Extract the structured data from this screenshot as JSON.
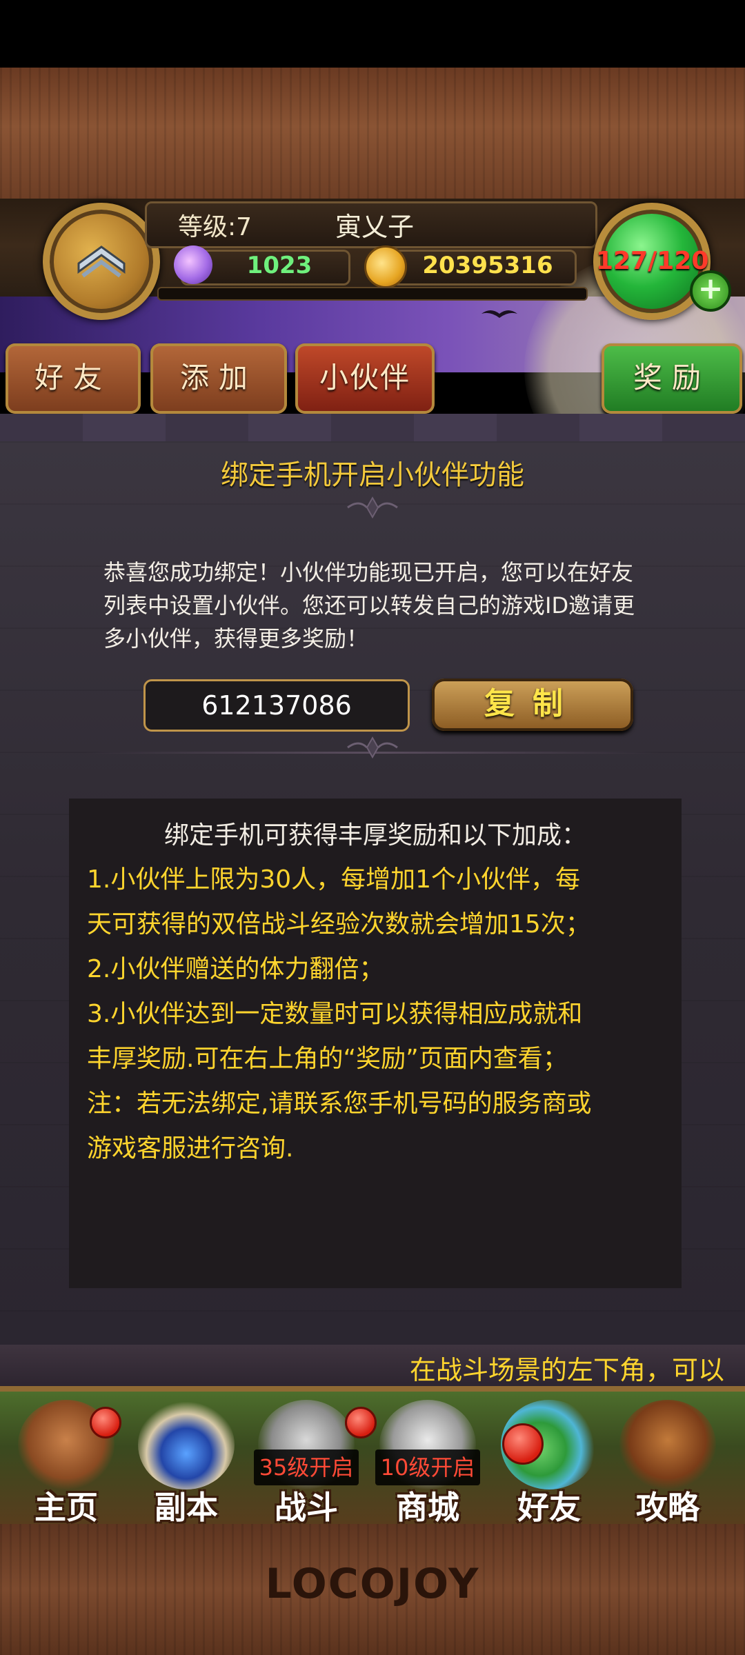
{
  "header": {
    "level_label": "等级:7",
    "player_name": "寅乂子",
    "gems": "1023",
    "gold": "20395316",
    "energy": "127/120",
    "plus_label": "+"
  },
  "tabs": [
    {
      "label": "好友"
    },
    {
      "label": "添加"
    },
    {
      "label": "小伙伴"
    },
    {
      "label": "奖励"
    }
  ],
  "panel": {
    "title": "绑定手机开启小伙伴功能",
    "intro": "恭喜您成功绑定！小伙伴功能现已开启，您可以在好友列表中设置小伙伴。您还可以转发自己的游戏ID邀请更多小伙伴，获得更多奖励！",
    "game_id": "612137086",
    "copy_label": "复制"
  },
  "info": {
    "heading": "绑定手机可获得丰厚奖励和以下加成：",
    "lines": [
      "1.小伙伴上限为30人，每增加1个小伙伴，每",
      "天可获得的双倍战斗经验次数就会增加15次；",
      "2.小伙伴赠送的体力翻倍；",
      "3.小伙伴达到一定数量时可以获得相应成就和",
      "丰厚奖励.可在右上角的“奖励”页面内查看；",
      "注：若无法绑定,请联系您手机号码的服务商或",
      "游戏客服进行咨询."
    ]
  },
  "ticker": "在战斗场景的左下角，可以",
  "nav": [
    {
      "label": "主页",
      "icon": "house-icon"
    },
    {
      "label": "副本",
      "icon": "skull-orb-icon"
    },
    {
      "label": "战斗",
      "icon": "crossed-swords-icon",
      "lock": "35级开启"
    },
    {
      "label": "商城",
      "icon": "cow-helmet-icon",
      "lock": "10级开启"
    },
    {
      "label": "好友",
      "icon": "monsters-icon"
    },
    {
      "label": "攻略",
      "icon": "book-icon"
    }
  ],
  "logo": "LOCOJOY",
  "colors": {
    "accent_gold": "#ffd52e",
    "reward_green": "#2f9a2c",
    "tab_red": "#a3301b",
    "panel_bg": "#2f2a33"
  }
}
